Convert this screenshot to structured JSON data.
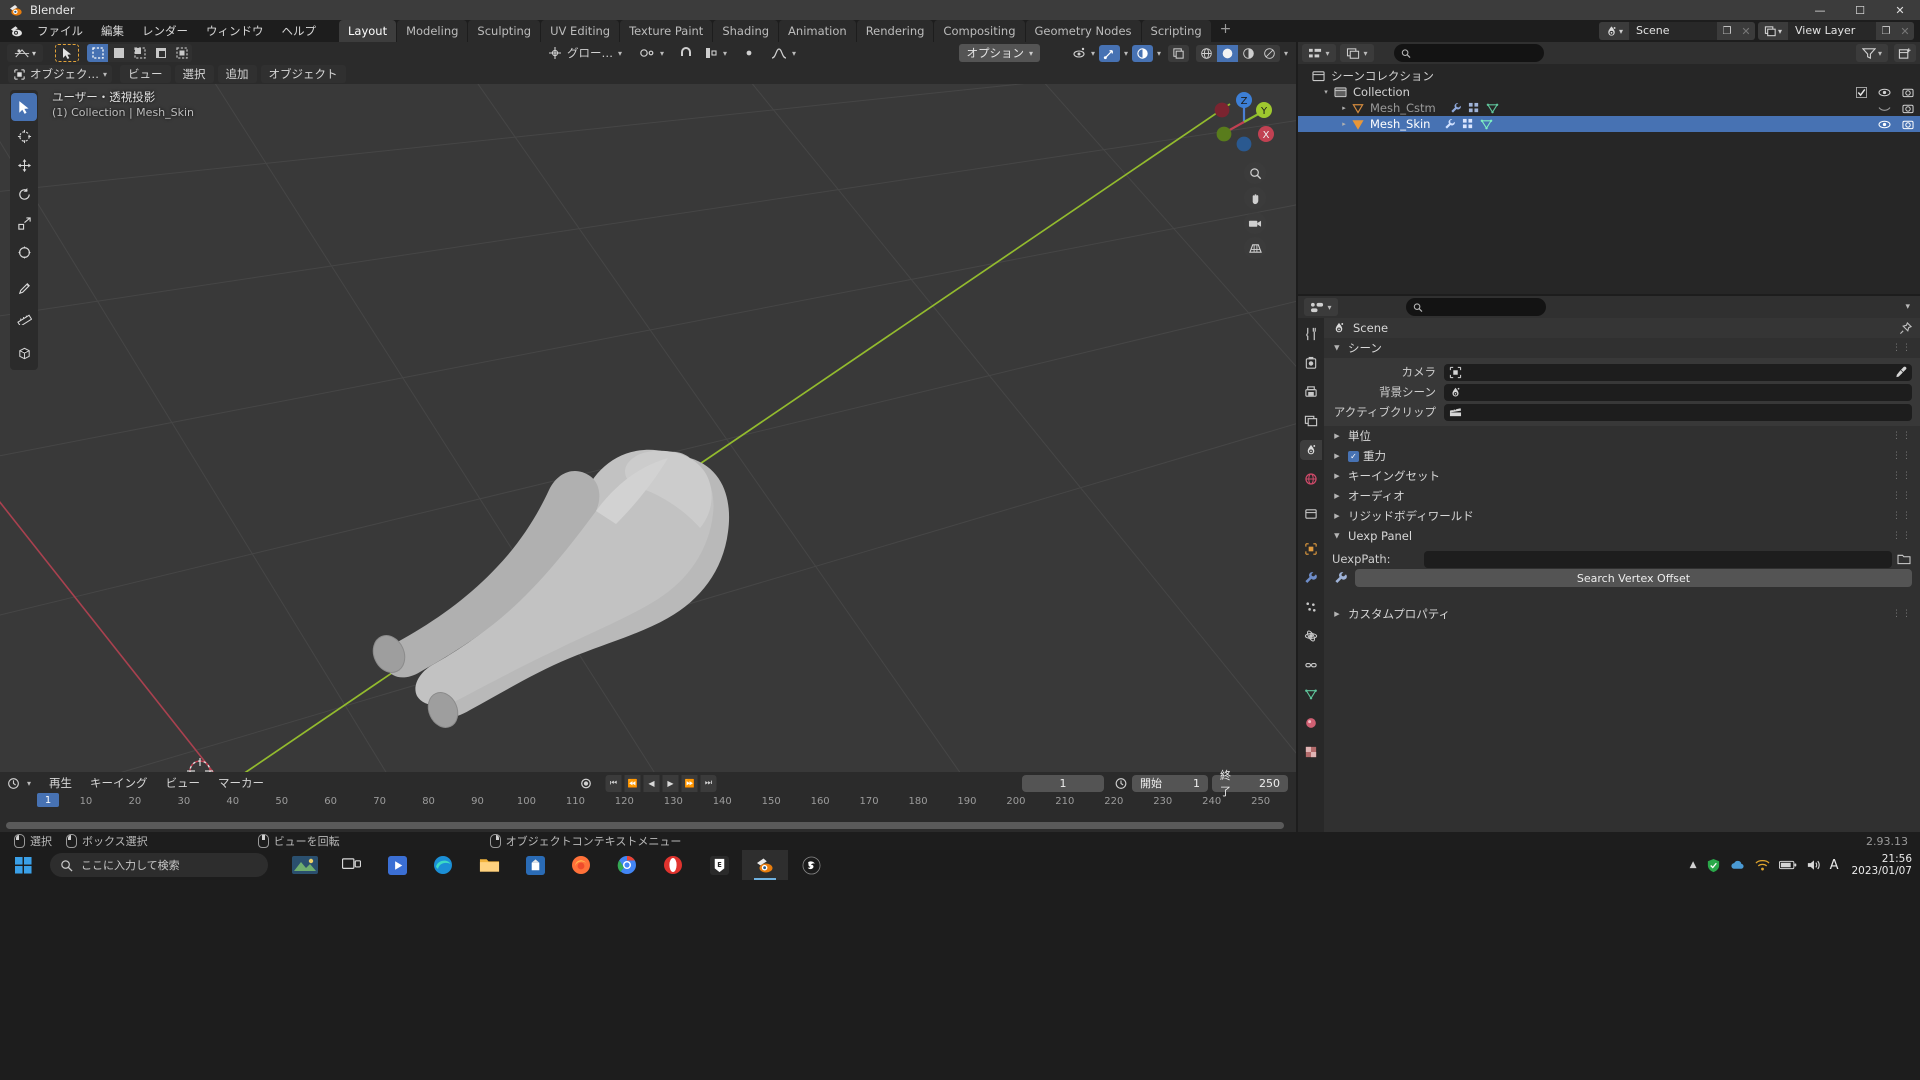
{
  "window": {
    "title": "Blender",
    "app_icon": "blender-logo-icon",
    "minimize": "—",
    "maximize": "☐",
    "close": "✕"
  },
  "topbar": {
    "menus": [
      "ファイル",
      "編集",
      "レンダー",
      "ウィンドウ",
      "ヘルプ"
    ],
    "workspaces": [
      {
        "label": "Layout",
        "active": true
      },
      {
        "label": "Modeling",
        "active": false
      },
      {
        "label": "Sculpting",
        "active": false
      },
      {
        "label": "UV Editing",
        "active": false
      },
      {
        "label": "Texture Paint",
        "active": false
      },
      {
        "label": "Shading",
        "active": false
      },
      {
        "label": "Animation",
        "active": false
      },
      {
        "label": "Rendering",
        "active": false
      },
      {
        "label": "Compositing",
        "active": false
      },
      {
        "label": "Geometry Nodes",
        "active": false
      },
      {
        "label": "Scripting",
        "active": false
      }
    ],
    "add_workspace": "+",
    "scene": {
      "name": "Scene",
      "copy": "❐",
      "unlink": "✕"
    },
    "view_layer": {
      "name": "View Layer",
      "copy": "❐",
      "unlink": "✕"
    }
  },
  "viewport": {
    "mode": "オブジェク…",
    "menus": [
      "ビュー",
      "選択",
      "追加",
      "オブジェクト"
    ],
    "transform_orientation": "グロー…",
    "options_label": "オプション",
    "overlay_line1": "ユーザー・透視投影",
    "overlay_line2": "(1) Collection | Mesh_Skin",
    "gizmo_axes": [
      "X",
      "Y",
      "Z"
    ],
    "tools": [
      "tweak-select-tool",
      "cursor-tool",
      "move-tool",
      "rotate-tool",
      "scale-tool",
      "transform-tool",
      "annotate-tool",
      "measure-tool",
      "add-cube-tool"
    ]
  },
  "outliner": {
    "display_mode": "view-layer-icon",
    "filter_icon": "filter-icon",
    "new_collection_icon": "new-collection-icon",
    "search_placeholder": "",
    "rows": [
      {
        "label": "シーンコレクション",
        "indent": 0,
        "icon": "scene-collection-icon",
        "expander": "",
        "selected": false,
        "dim": false,
        "checkbox": false,
        "eye": false,
        "camera": false
      },
      {
        "label": "Collection",
        "indent": 1,
        "icon": "collection-icon",
        "expander": "▾",
        "selected": false,
        "dim": false,
        "checkbox": true,
        "eye": true,
        "camera": true
      },
      {
        "label": "Mesh_Cstm",
        "indent": 2,
        "icon": "mesh-object-icon",
        "expander": "▸",
        "selected": false,
        "dim": true,
        "checkbox": false,
        "eye": true,
        "camera": true
      },
      {
        "label": "Mesh_Skin",
        "indent": 2,
        "icon": "mesh-object-icon",
        "expander": "▸",
        "selected": true,
        "dim": false,
        "checkbox": false,
        "eye": true,
        "camera": true
      }
    ]
  },
  "properties": {
    "search_placeholder": "",
    "breadcrumb": "Scene",
    "tabs": [
      "tool-icon",
      "render-icon",
      "output-icon",
      "view-layer-icon",
      "scene-icon",
      "world-icon",
      "collection-icon",
      "object-icon",
      "modifier-icon",
      "particles-icon",
      "physics-icon",
      "constraints-icon",
      "data-icon",
      "material-icon",
      "texture-icon"
    ],
    "active_tab_index": 4,
    "panels": [
      {
        "label": "シーン",
        "open": true,
        "checkbox": false
      },
      {
        "label": "単位",
        "open": false,
        "checkbox": false
      },
      {
        "label": "重力",
        "open": false,
        "checkbox": true
      },
      {
        "label": "キーイングセット",
        "open": false,
        "checkbox": false
      },
      {
        "label": "オーディオ",
        "open": false,
        "checkbox": false
      },
      {
        "label": "リジッドボディワールド",
        "open": false,
        "checkbox": false
      }
    ],
    "scene_fields": [
      {
        "label": "カメラ",
        "value": "",
        "icon": "camera-icon",
        "eyedropper": true
      },
      {
        "label": "背景シーン",
        "value": "",
        "icon": "scene-icon",
        "eyedropper": false
      },
      {
        "label": "アクティブクリップ",
        "value": "",
        "icon": "clip-icon",
        "eyedropper": false
      }
    ],
    "uexp_panel": {
      "title": "Uexp Panel",
      "path_label": "UexpPath:",
      "path_value": "",
      "folder_icon": "folder-icon",
      "button_label": "Search Vertex Offset",
      "button_icon": "wrench-icon"
    },
    "custom_props": {
      "label": "カスタムプロパティ",
      "open": false
    }
  },
  "timeline": {
    "menus": [
      "再生",
      "キーイング",
      "ビュー",
      "マーカー"
    ],
    "transport": [
      "⏮",
      "⏪",
      "◀",
      "▶",
      "⏩",
      "⏭"
    ],
    "record_icon": "record-icon",
    "current_frame": "1",
    "start_label": "開始",
    "start_value": "1",
    "end_label": "終了",
    "end_value": "250",
    "playhead_label": "1",
    "ticks": [
      "10",
      "20",
      "30",
      "40",
      "50",
      "60",
      "70",
      "80",
      "90",
      "100",
      "110",
      "120",
      "130",
      "140",
      "150",
      "160",
      "170",
      "180",
      "190",
      "200",
      "210",
      "220",
      "230",
      "240",
      "250"
    ]
  },
  "statusbar": {
    "items": [
      {
        "mouse": "left",
        "label": "選択"
      },
      {
        "mouse": "left-drag",
        "label": "ボックス選択"
      },
      {
        "mouse": "middle",
        "label": "ビューを回転"
      },
      {
        "mouse": "right",
        "label": "オブジェクトコンテキストメニュー"
      }
    ],
    "version": "2.93.13"
  },
  "taskbar": {
    "start_icon": "windows-start-icon",
    "search_placeholder": "ここに入力して検索",
    "search_icon": "search-icon",
    "items": [
      {
        "name": "task-view-icon"
      },
      {
        "name": "photos-icon"
      },
      {
        "name": "task-view-button"
      },
      {
        "name": "media-player-icon"
      },
      {
        "name": "edge-icon"
      },
      {
        "name": "file-explorer-icon"
      },
      {
        "name": "store-icon"
      },
      {
        "name": "firefox-icon"
      },
      {
        "name": "chrome-icon"
      },
      {
        "name": "opera-icon"
      },
      {
        "name": "epic-games-icon"
      },
      {
        "name": "blender-icon"
      },
      {
        "name": "unreal-icon"
      }
    ],
    "tray": [
      "chevron-up-icon",
      "shield-icon",
      "cloud-icon",
      "network-icon",
      "battery-icon",
      "volume-icon",
      "ime-icon"
    ],
    "clock_time": "21:56",
    "clock_date": "2023/01/07"
  },
  "colors": {
    "accent": "#4772b3",
    "axis_x": "#c14152",
    "axis_y": "#8dbb2d",
    "bg_viewport": "#393939",
    "panel_bg": "#303030",
    "outliner_bg": "#262626",
    "mesh": "#b4b4b4"
  }
}
